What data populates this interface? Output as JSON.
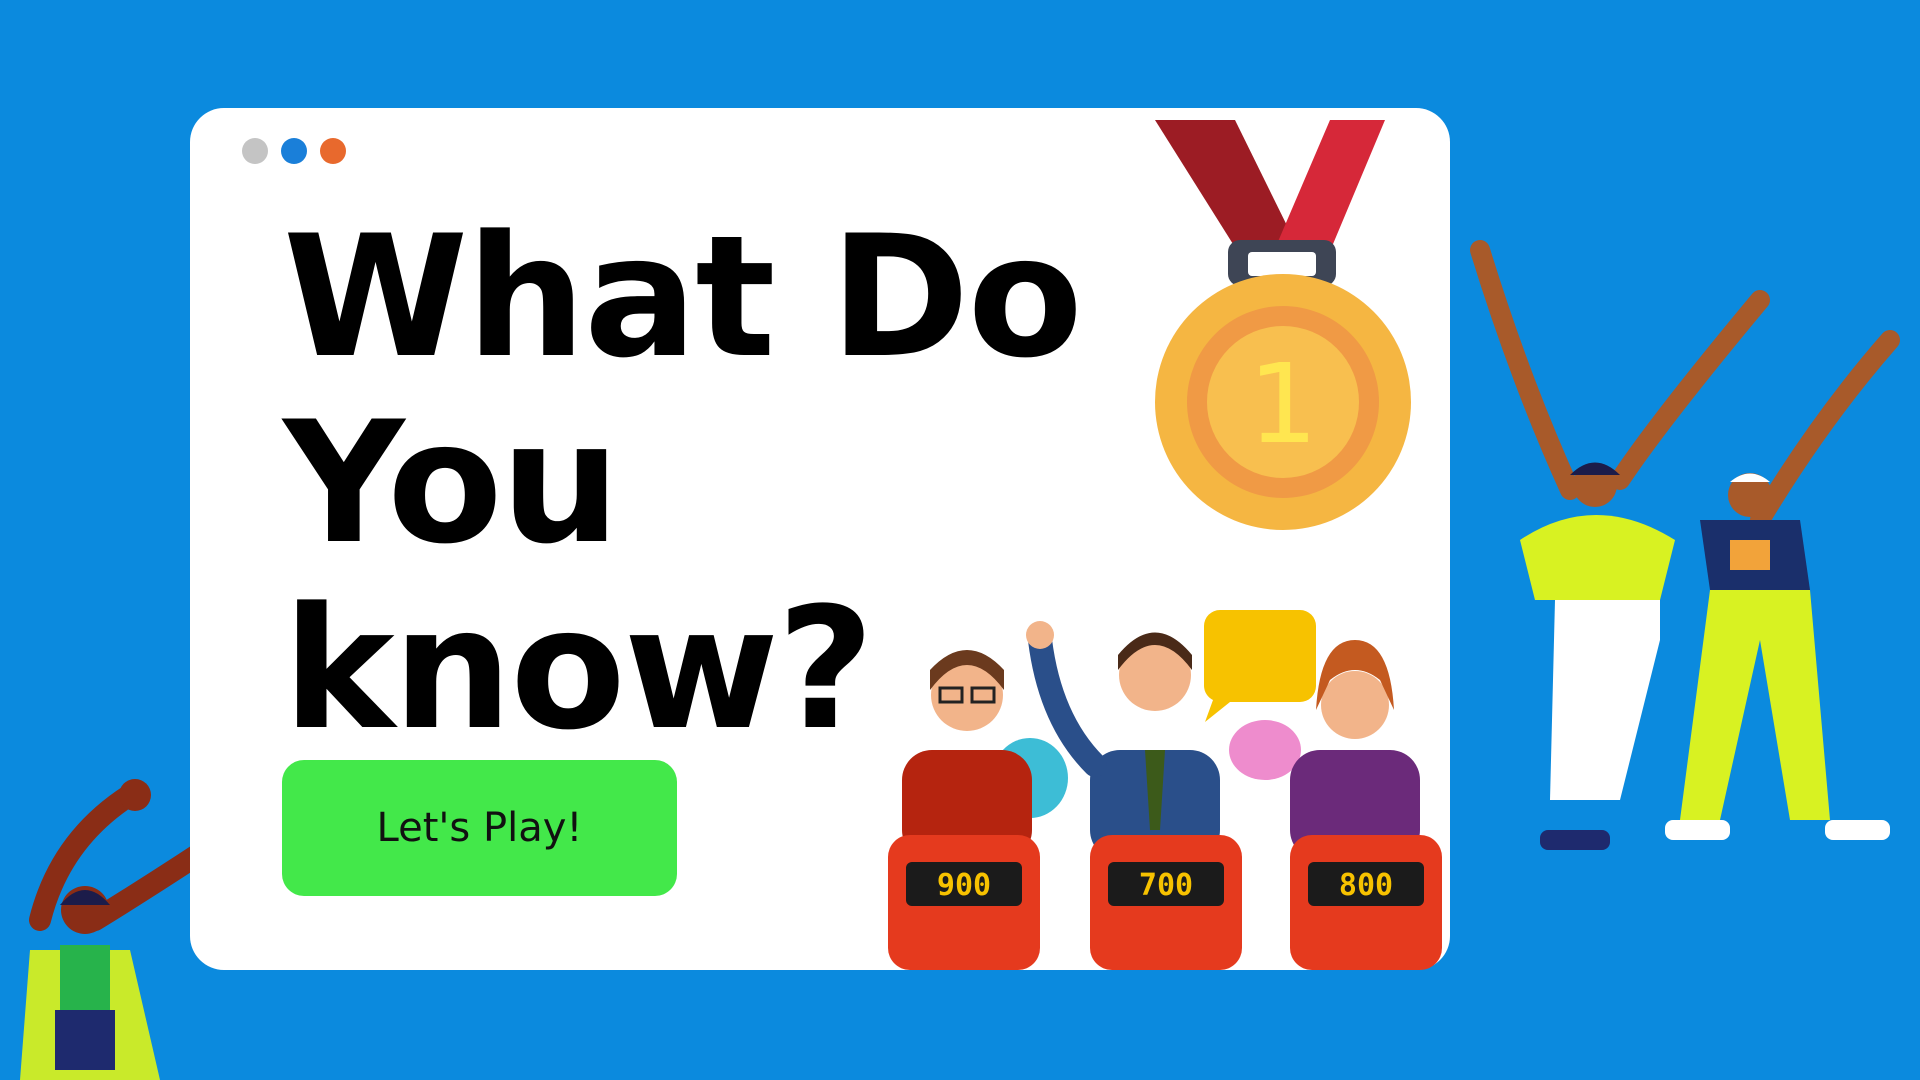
{
  "window": {
    "dots": [
      {
        "name": "window-dot-gray",
        "color": "#c4c4c4"
      },
      {
        "name": "window-dot-blue",
        "color": "#1a7fd9"
      },
      {
        "name": "window-dot-orange",
        "color": "#e8692d"
      }
    ]
  },
  "hero": {
    "title_line1": "What Do",
    "title_line2": "You",
    "title_line3": "know?"
  },
  "cta": {
    "label": "Let's Play!",
    "color": "#43e84a"
  },
  "medal": {
    "number": "1"
  },
  "podiums": [
    {
      "score": "900"
    },
    {
      "score": "700"
    },
    {
      "score": "800"
    }
  ],
  "colors": {
    "background": "#0b8ade",
    "card": "#ffffff",
    "podium": "#e53a1e",
    "medal_gold": "#f5b642"
  },
  "icons": {
    "medal": "gold-medal-icon",
    "speech_bubble": "speech-bubble-icon"
  }
}
